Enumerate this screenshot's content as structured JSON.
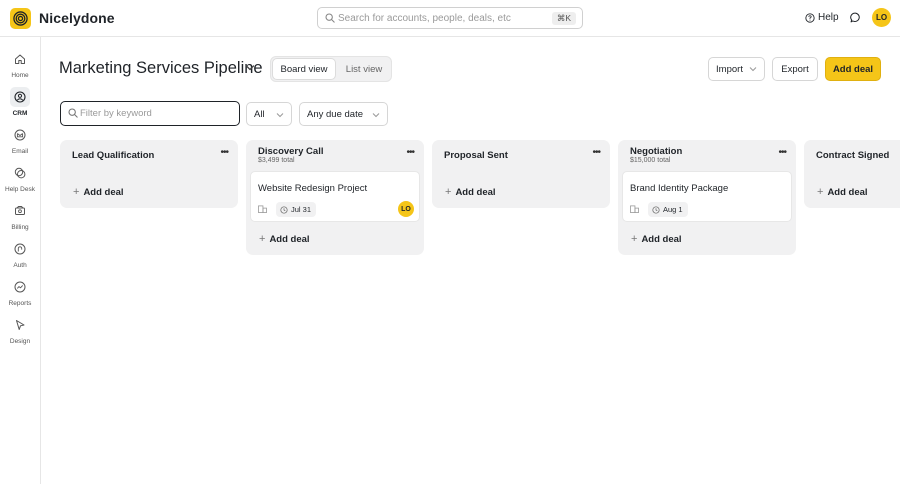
{
  "app": {
    "name": "Nicelydone",
    "brand_color": "#f5c518",
    "search_placeholder": "Search for accounts, people, deals, etc",
    "search_shortcut": "⌘K",
    "help_label": "Help",
    "user_initials": "LO"
  },
  "sidebar": {
    "items": [
      {
        "label": "Home",
        "icon": "home-icon"
      },
      {
        "label": "CRM",
        "icon": "crm-icon",
        "active": true
      },
      {
        "label": "Email",
        "icon": "email-icon"
      },
      {
        "label": "Help Desk",
        "icon": "help-desk-icon"
      },
      {
        "label": "Billing",
        "icon": "billing-icon"
      },
      {
        "label": "Auth",
        "icon": "auth-icon"
      },
      {
        "label": "Reports",
        "icon": "reports-icon"
      },
      {
        "label": "Design",
        "icon": "design-icon"
      }
    ]
  },
  "header": {
    "title": "Marketing Services Pipeline",
    "views": {
      "board": "Board view",
      "list": "List view",
      "active": "board"
    },
    "import_label": "Import",
    "export_label": "Export",
    "add_deal_label": "Add deal"
  },
  "filters": {
    "keyword_placeholder": "Filter by keyword",
    "owner_value": "All",
    "due_value": "Any due date"
  },
  "columns": [
    {
      "title": "Lead Qualification",
      "total": "",
      "add_label": "Add deal",
      "deals": []
    },
    {
      "title": "Discovery Call",
      "total": "$3,499 total",
      "add_label": "Add deal",
      "deals": [
        {
          "title": "Website Redesign Project",
          "date": "Jul 31",
          "owner_initials": "LO"
        }
      ]
    },
    {
      "title": "Proposal Sent",
      "total": "",
      "add_label": "Add deal",
      "deals": []
    },
    {
      "title": "Negotiation",
      "total": "$15,000 total",
      "add_label": "Add deal",
      "deals": [
        {
          "title": "Brand Identity Package",
          "date": "Aug 1",
          "owner_initials": ""
        }
      ]
    },
    {
      "title": "Contract Signed",
      "total": "",
      "add_label": "Add deal",
      "deals": []
    }
  ]
}
